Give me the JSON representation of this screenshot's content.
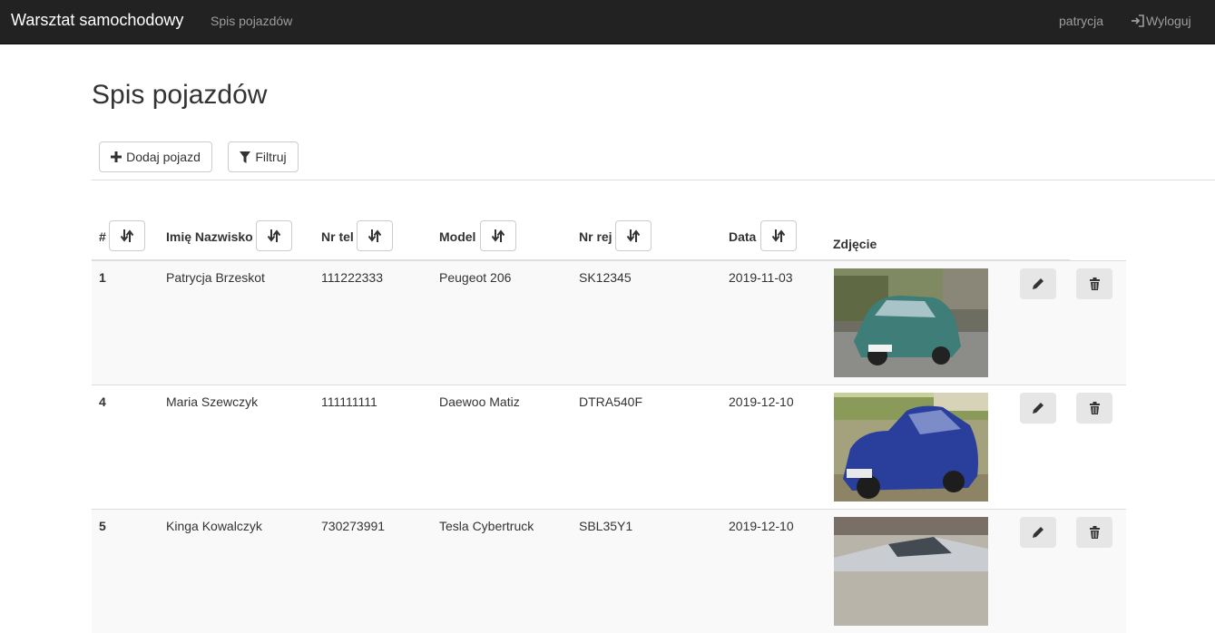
{
  "navbar": {
    "brand": "Warsztat samochodowy",
    "vehicles_link": "Spis pojazdów",
    "user": "patrycja",
    "logout": "Wyloguj"
  },
  "page": {
    "title": "Spis pojazdów"
  },
  "toolbar": {
    "add_label": "Dodaj pojazd",
    "filter_label": "Filtruj"
  },
  "table": {
    "columns": {
      "id": "#",
      "name": "Imię Nazwisko",
      "phone": "Nr tel",
      "model": "Model",
      "reg": "Nr rej",
      "date": "Data",
      "photo": "Zdjęcie"
    },
    "rows": [
      {
        "id": "1",
        "name": "Patrycja Brzeskot",
        "phone": "111222333",
        "model": "Peugeot 206",
        "reg": "SK12345",
        "date": "2019-11-03"
      },
      {
        "id": "4",
        "name": "Maria Szewczyk",
        "phone": "111111111",
        "model": "Daewoo Matiz",
        "reg": "DTRA540F",
        "date": "2019-12-10"
      },
      {
        "id": "5",
        "name": "Kinga Kowalczyk",
        "phone": "730273991",
        "model": "Tesla Cybertruck",
        "reg": "SBL35Y1",
        "date": "2019-12-10"
      }
    ]
  },
  "colors": {
    "navbar_bg": "#222222",
    "row_stripe": "#f9f9f9",
    "border": "#dddddd"
  }
}
